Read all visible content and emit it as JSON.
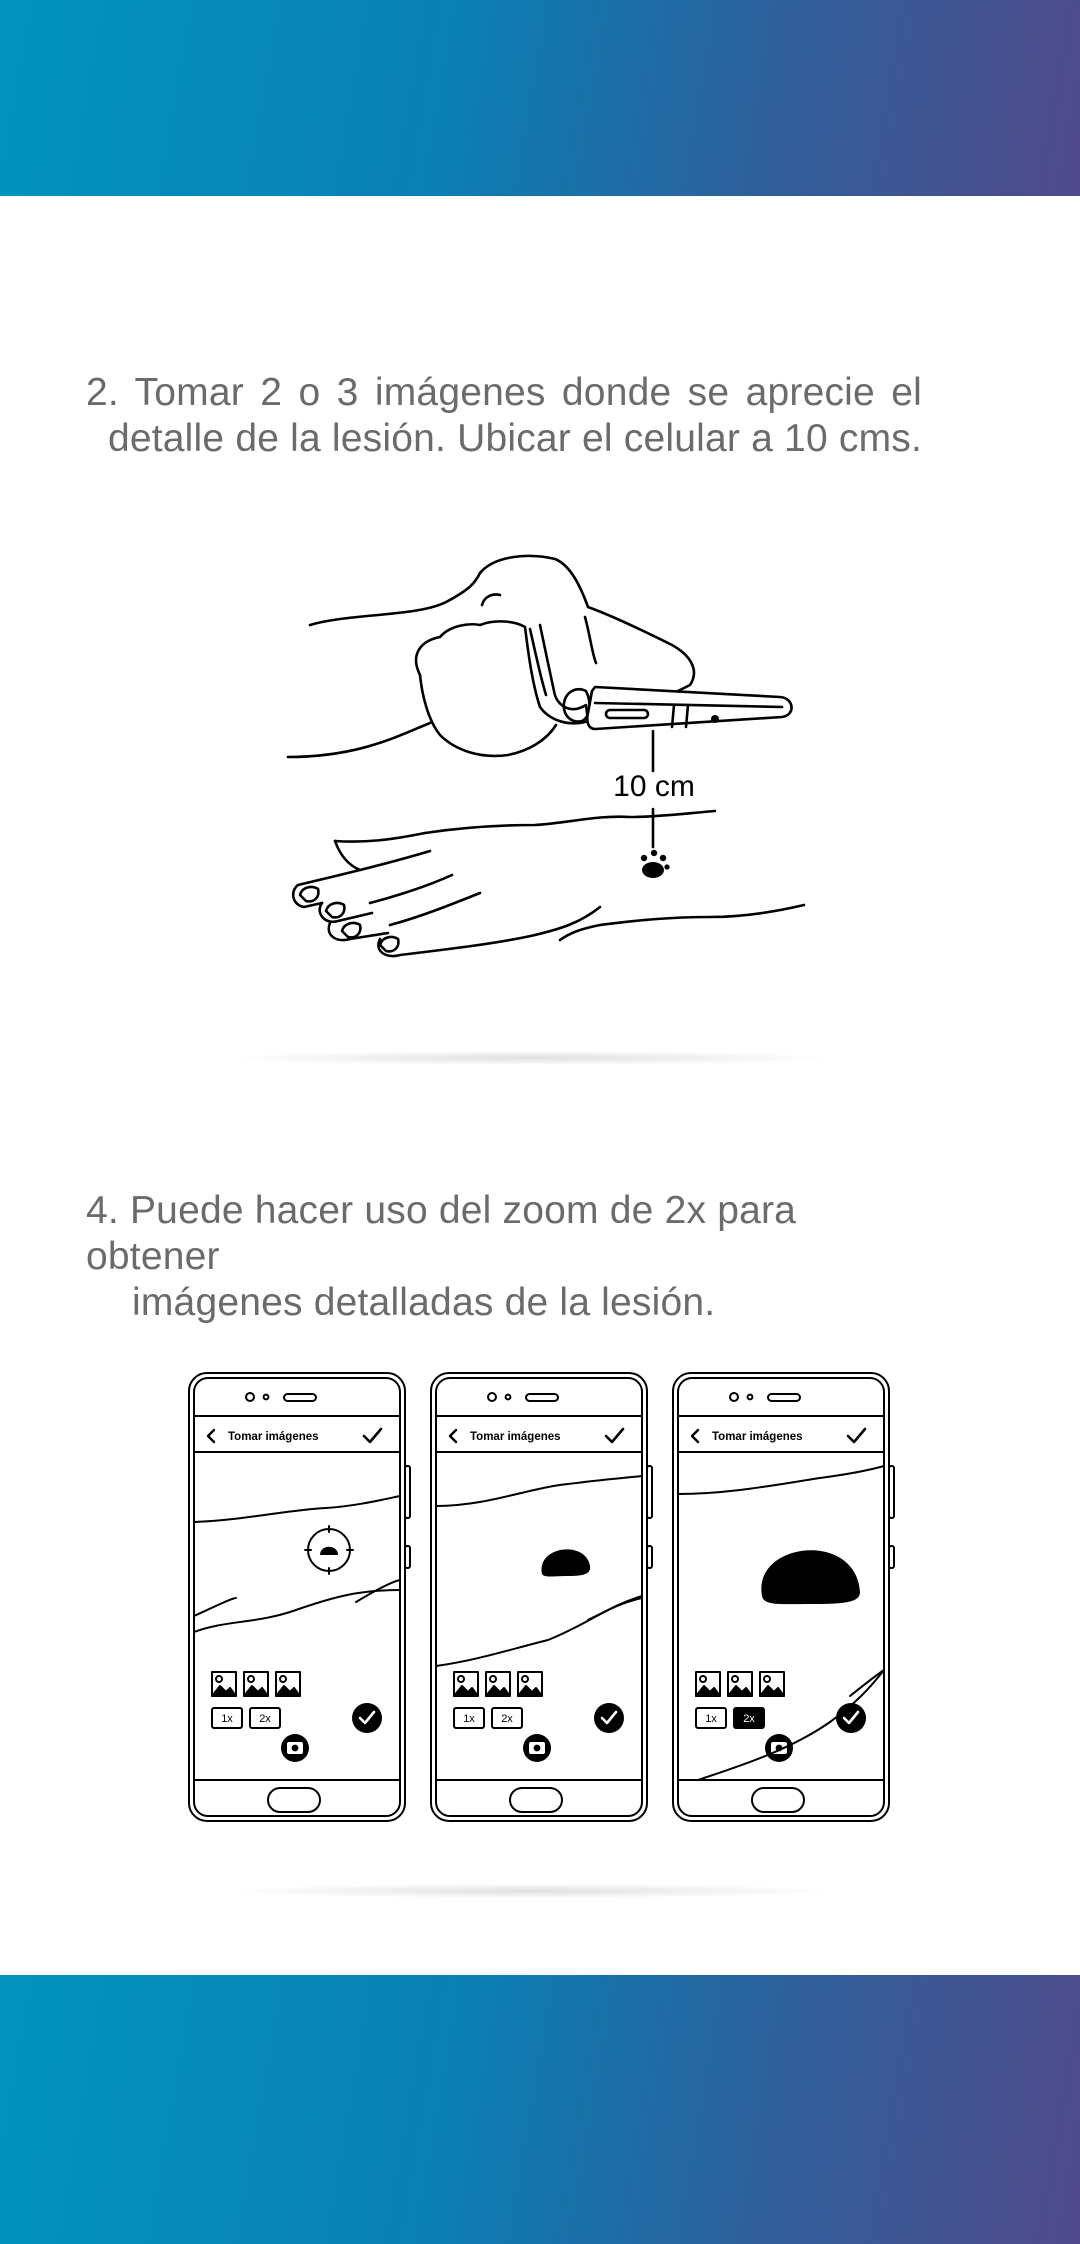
{
  "colors": {
    "band_gradient_start": "#0194bf",
    "band_gradient_end": "#514a8a",
    "text": "#6b6b6b",
    "line_art": "#000000"
  },
  "step2": {
    "line1": "2. Tomar 2 o 3 imágenes donde se aprecie el",
    "line2": "detalle de la lesión. Ubicar el celular a 10 cms."
  },
  "illustration1": {
    "distance_label": "10 cm"
  },
  "step4": {
    "line1": "4. Puede hacer uso del zoom de 2x para obtener",
    "line2": "imágenes detalladas de la lesión."
  },
  "phones": [
    {
      "title": "Tomar imágenes",
      "zoom_1x": "1x",
      "zoom_2x": "2x",
      "active_zoom": "1x"
    },
    {
      "title": "Tomar imágenes",
      "zoom_1x": "1x",
      "zoom_2x": "2x",
      "active_zoom": "1x"
    },
    {
      "title": "Tomar imágenes",
      "zoom_1x": "1x",
      "zoom_2x": "2x",
      "active_zoom": "2x"
    }
  ],
  "icons": [
    "back-chevron-icon",
    "checkmark-icon",
    "image-thumbnail-icon",
    "camera-icon",
    "confirm-check-icon",
    "home-button-icon"
  ]
}
